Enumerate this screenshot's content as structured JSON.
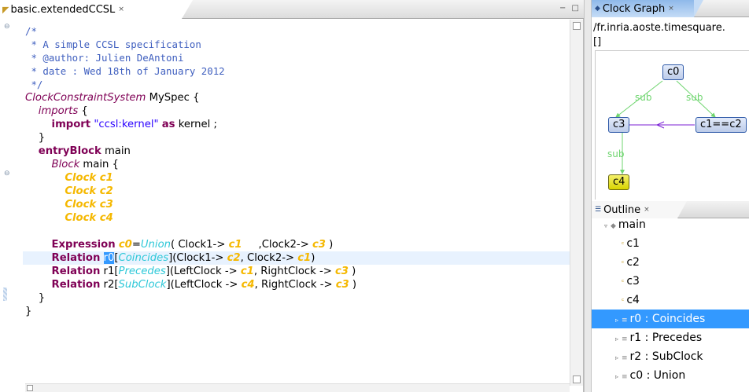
{
  "editor": {
    "tab_title": "basic.extendedCCSL",
    "close_glyph": "×",
    "pane_controls": "− □"
  },
  "code_lines": [
    {
      "spans": [
        {
          "c": "cm",
          "t": "/*"
        }
      ]
    },
    {
      "spans": [
        {
          "c": "cm",
          "t": " * A simple CCSL specification"
        }
      ]
    },
    {
      "spans": [
        {
          "c": "cm",
          "t": " * @author: Julien DeAntoni"
        }
      ]
    },
    {
      "spans": [
        {
          "c": "cm",
          "t": " * date : Wed 18th of January 2012"
        }
      ]
    },
    {
      "spans": [
        {
          "c": "cm",
          "t": " */"
        }
      ]
    },
    {
      "spans": [
        {
          "c": "kwi",
          "t": "ClockConstraintSystem"
        },
        {
          "c": "id",
          "t": " MySpec {"
        }
      ]
    },
    {
      "spans": [
        {
          "c": "id",
          "t": "    "
        },
        {
          "c": "kwi",
          "t": "imports"
        },
        {
          "c": "id",
          "t": " {"
        }
      ]
    },
    {
      "spans": [
        {
          "c": "id",
          "t": "        "
        },
        {
          "c": "kw",
          "t": "import"
        },
        {
          "c": "id",
          "t": " "
        },
        {
          "c": "str",
          "t": "\"ccsl:kernel\""
        },
        {
          "c": "id",
          "t": " "
        },
        {
          "c": "kw",
          "t": "as"
        },
        {
          "c": "id",
          "t": " kernel ;"
        }
      ]
    },
    {
      "spans": [
        {
          "c": "id",
          "t": "    }"
        }
      ]
    },
    {
      "spans": [
        {
          "c": "id",
          "t": "    "
        },
        {
          "c": "kw",
          "t": "entryBlock"
        },
        {
          "c": "id",
          "t": " main"
        }
      ]
    },
    {
      "spans": [
        {
          "c": "id",
          "t": "        "
        },
        {
          "c": "kwi",
          "t": "Block"
        },
        {
          "c": "id",
          "t": " main {"
        }
      ]
    },
    {
      "spans": [
        {
          "c": "id",
          "t": "            "
        },
        {
          "c": "clk",
          "t": "Clock c1"
        }
      ]
    },
    {
      "spans": [
        {
          "c": "id",
          "t": "            "
        },
        {
          "c": "clk",
          "t": "Clock c2"
        }
      ]
    },
    {
      "spans": [
        {
          "c": "id",
          "t": "            "
        },
        {
          "c": "clk",
          "t": "Clock c3"
        }
      ]
    },
    {
      "spans": [
        {
          "c": "id",
          "t": "            "
        },
        {
          "c": "clk",
          "t": "Clock c4"
        }
      ]
    },
    {
      "spans": [
        {
          "c": "id",
          "t": " "
        }
      ]
    },
    {
      "spans": [
        {
          "c": "id",
          "t": "        "
        },
        {
          "c": "kw",
          "t": "Expression"
        },
        {
          "c": "id",
          "t": " "
        },
        {
          "c": "clk",
          "t": "c0"
        },
        {
          "c": "id",
          "t": "="
        },
        {
          "c": "rel",
          "t": "Union"
        },
        {
          "c": "id",
          "t": "( Clock1-> "
        },
        {
          "c": "clk",
          "t": "c1"
        },
        {
          "c": "id",
          "t": "     ,Clock2-> "
        },
        {
          "c": "clk",
          "t": "c3"
        },
        {
          "c": "id",
          "t": " )"
        }
      ]
    },
    {
      "hl": true,
      "spans": [
        {
          "c": "id",
          "t": "        "
        },
        {
          "c": "kw",
          "t": "Relation"
        },
        {
          "c": "id",
          "t": " "
        },
        {
          "c": "sel",
          "t": "r0"
        },
        {
          "c": "id",
          "t": "["
        },
        {
          "c": "rel",
          "t": "Coincides"
        },
        {
          "c": "id",
          "t": "](Clock1-> "
        },
        {
          "c": "clk",
          "t": "c2"
        },
        {
          "c": "id",
          "t": ", Clock2-> "
        },
        {
          "c": "clk",
          "t": "c1"
        },
        {
          "c": "id",
          "t": ")"
        }
      ]
    },
    {
      "spans": [
        {
          "c": "id",
          "t": "        "
        },
        {
          "c": "kw",
          "t": "Relation"
        },
        {
          "c": "id",
          "t": " r1["
        },
        {
          "c": "rel",
          "t": "Precedes"
        },
        {
          "c": "id",
          "t": "](LeftClock -> "
        },
        {
          "c": "clk",
          "t": "c1"
        },
        {
          "c": "id",
          "t": ", RightClock -> "
        },
        {
          "c": "clk",
          "t": "c3"
        },
        {
          "c": "id",
          "t": " )"
        }
      ]
    },
    {
      "spans": [
        {
          "c": "id",
          "t": "        "
        },
        {
          "c": "kw",
          "t": "Relation"
        },
        {
          "c": "id",
          "t": " r2["
        },
        {
          "c": "rel",
          "t": "SubClock"
        },
        {
          "c": "id",
          "t": "](LeftClock -> "
        },
        {
          "c": "clk",
          "t": "c4"
        },
        {
          "c": "id",
          "t": ", RightClock -> "
        },
        {
          "c": "clk",
          "t": "c3"
        },
        {
          "c": "id",
          "t": " )"
        }
      ]
    },
    {
      "spans": [
        {
          "c": "id",
          "t": "    }"
        }
      ]
    },
    {
      "spans": [
        {
          "c": "id",
          "t": "}"
        }
      ]
    }
  ],
  "clock_graph": {
    "tab_title": "Clock Graph",
    "path": "/fr.inria.aoste.timesquare.",
    "bracket": "[]",
    "nodes": {
      "c0": "c0",
      "c3": "c3",
      "c1c2": "c1==c2",
      "c4": "c4"
    },
    "edge_labels": {
      "left": "sub",
      "right": "sub",
      "bottom": "sub"
    }
  },
  "outline": {
    "tab_title": "Outline",
    "items": [
      {
        "label": "main",
        "level": 0,
        "twisty": "▿",
        "icon": "◆",
        "grey": true
      },
      {
        "label": "c1",
        "level": 1,
        "twisty": "",
        "icon": "ᶜ",
        "grey": false
      },
      {
        "label": "c2",
        "level": 1,
        "twisty": "",
        "icon": "ᶜ",
        "grey": false
      },
      {
        "label": "c3",
        "level": 1,
        "twisty": "",
        "icon": "ᶜ",
        "grey": false
      },
      {
        "label": "c4",
        "level": 1,
        "twisty": "",
        "icon": "ᶜ",
        "grey": false
      },
      {
        "label": "r0 : Coincides",
        "level": 1,
        "twisty": "▹",
        "icon": "≡",
        "grey": true,
        "selected": true
      },
      {
        "label": "r1 : Precedes",
        "level": 1,
        "twisty": "▹",
        "icon": "≡",
        "grey": true
      },
      {
        "label": "r2 : SubClock",
        "level": 1,
        "twisty": "▹",
        "icon": "≡",
        "grey": true
      },
      {
        "label": "c0 : Union",
        "level": 1,
        "twisty": "▹",
        "icon": "≡",
        "grey": true
      }
    ]
  },
  "colors": {
    "selection": "#3399ff",
    "keyword": "#7f0055",
    "comment": "#3f5fbf",
    "clock": "#f5b800",
    "relation": "#2ec8d8",
    "graph_edge_green": "#6fd56f",
    "graph_edge_purple": "#7b1fd6"
  }
}
